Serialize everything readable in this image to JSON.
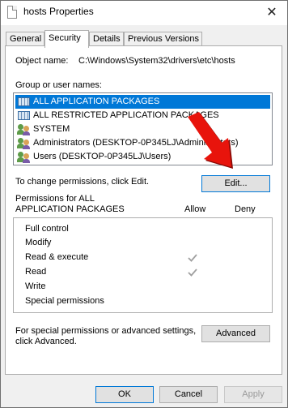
{
  "window": {
    "title": "hosts Properties",
    "close_glyph": "✕"
  },
  "tabs": [
    {
      "label": "General"
    },
    {
      "label": "Security"
    },
    {
      "label": "Details"
    },
    {
      "label": "Previous Versions"
    }
  ],
  "security": {
    "object_name_label": "Object name:",
    "object_name_value": "C:\\Windows\\System32\\drivers\\etc\\hosts",
    "group_label": "Group or user names:",
    "groups": [
      {
        "label": "ALL APPLICATION PACKAGES",
        "icon": "package-icon",
        "selected": true
      },
      {
        "label": "ALL RESTRICTED APPLICATION PACKAGES",
        "icon": "package-icon"
      },
      {
        "label": "SYSTEM",
        "icon": "users-icon"
      },
      {
        "label": "Administrators (DESKTOP-0P345LJ\\Administrators)",
        "icon": "users-icon"
      },
      {
        "label": "Users (DESKTOP-0P345LJ\\Users)",
        "icon": "users-icon"
      }
    ],
    "change_hint": "To change permissions, click Edit.",
    "edit_button": "Edit...",
    "permissions_for_line1": "Permissions for ALL",
    "permissions_for_line2": "APPLICATION PACKAGES",
    "allow_header": "Allow",
    "deny_header": "Deny",
    "permissions": [
      {
        "name": "Full control",
        "allow": false,
        "deny": false
      },
      {
        "name": "Modify",
        "allow": false,
        "deny": false
      },
      {
        "name": "Read & execute",
        "allow": true,
        "deny": false
      },
      {
        "name": "Read",
        "allow": true,
        "deny": false
      },
      {
        "name": "Write",
        "allow": false,
        "deny": false
      },
      {
        "name": "Special permissions",
        "allow": false,
        "deny": false
      }
    ],
    "advanced_hint_line1": "For special permissions or advanced settings,",
    "advanced_hint_line2": "click Advanced.",
    "advanced_button": "Advanced"
  },
  "footer": {
    "ok": "OK",
    "cancel": "Cancel",
    "apply": "Apply"
  },
  "colors": {
    "selection": "#0078d7",
    "arrow": "#e8140c",
    "check_disabled": "#a0a0a0"
  }
}
